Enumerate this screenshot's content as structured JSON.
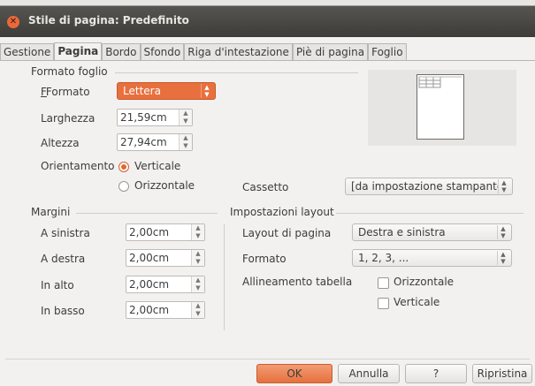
{
  "window": {
    "title": "Stile di pagina: Predefinito"
  },
  "tabs": [
    "Gestione",
    "Pagina",
    "Bordo",
    "Sfondo",
    "Riga d'intestazione",
    "Piè di pagina",
    "Foglio"
  ],
  "active_tab": "Pagina",
  "formato_foglio": {
    "heading": "Formato foglio",
    "formato": {
      "label": "Formato",
      "value": "Lettera"
    },
    "larghezza": {
      "label": "Larghezza",
      "value": "21,59cm"
    },
    "altezza": {
      "label": "Altezza",
      "value": "27,94cm"
    },
    "orientamento": {
      "label": "Orientamento",
      "options": [
        "Verticale",
        "Orizzontale"
      ],
      "selected": "Verticale"
    },
    "cassetto": {
      "label": "Cassetto",
      "value": "[da impostazione stampante]"
    }
  },
  "margini": {
    "heading": "Margini",
    "sinistra": {
      "label": "A sinistra",
      "value": "2,00cm"
    },
    "destra": {
      "label": "A destra",
      "value": "2,00cm"
    },
    "alto": {
      "label": "In alto",
      "value": "2,00cm"
    },
    "basso": {
      "label": "In basso",
      "value": "2,00cm"
    }
  },
  "layout": {
    "heading": "Impostazioni layout",
    "layout_pagina": {
      "label": "Layout di pagina",
      "value": "Destra e sinistra"
    },
    "formato": {
      "label": "Formato",
      "value": "1, 2, 3, ..."
    },
    "allineamento": {
      "label": "Allineamento tabella",
      "orizzontale": "Orizzontale",
      "verticale": "Verticale"
    }
  },
  "buttons": {
    "ok": "OK",
    "annulla": "Annulla",
    "help": "?",
    "ripristina": "Ripristina"
  },
  "colors": {
    "accent": "#e8703e",
    "titlebar": "#3d3c38"
  }
}
